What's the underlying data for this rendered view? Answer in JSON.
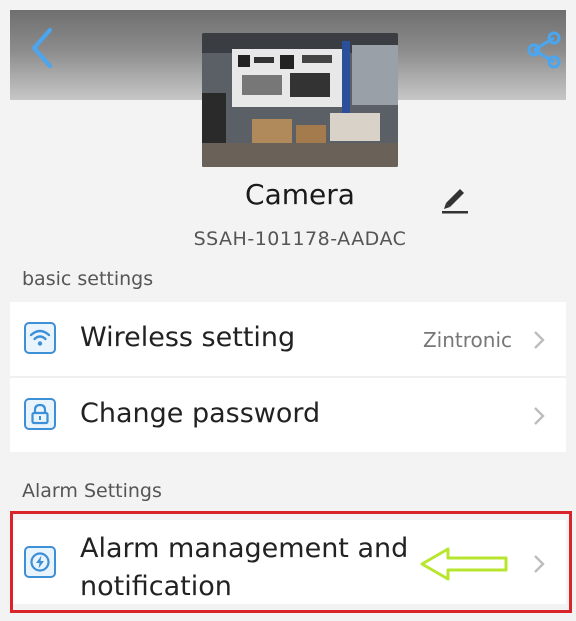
{
  "device": {
    "name": "Camera",
    "id": "SSAH-101178-AADAC"
  },
  "sections": {
    "basic": "basic settings",
    "alarm": "Alarm Settings"
  },
  "rows": {
    "wireless": {
      "label": "Wireless setting",
      "value": "Zintronic"
    },
    "password": {
      "label": "Change password"
    },
    "alarm": {
      "label_line1": "Alarm management and",
      "label_line2": "notification"
    }
  },
  "icons": {
    "back": "back-arrow-icon",
    "share": "share-icon",
    "edit": "pencil-icon",
    "wifi": "wifi-icon",
    "lock": "lock-icon",
    "alarm": "alarm-icon",
    "chevron": "chevron-right-icon",
    "pointer": "pointer-arrow-icon"
  },
  "colors": {
    "accent": "#3d8fd6",
    "highlight": "#d9252a",
    "pointer_arrow": "#b8e62e"
  }
}
